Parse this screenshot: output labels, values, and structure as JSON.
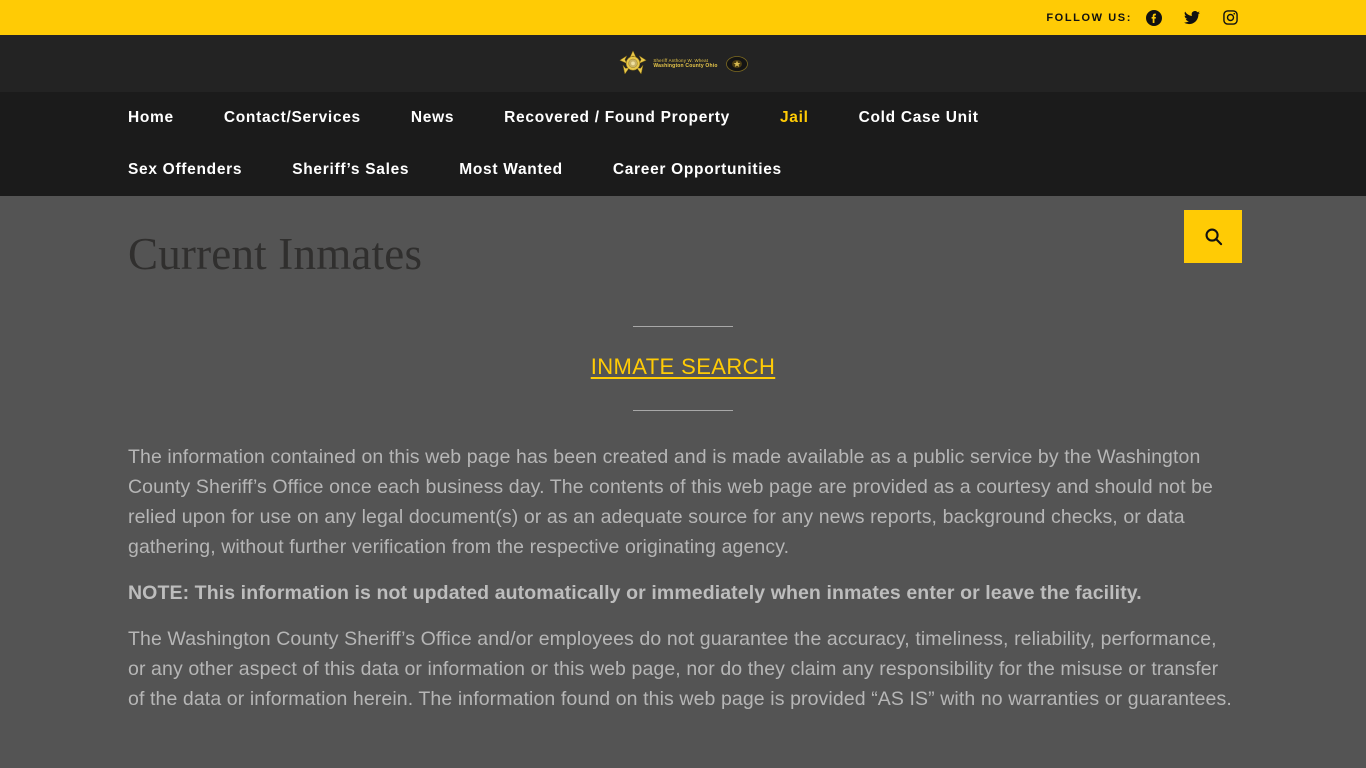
{
  "topbar": {
    "follow_label": "FOLLOW US:",
    "social": [
      {
        "name": "facebook-icon",
        "label": "Facebook"
      },
      {
        "name": "twitter-icon",
        "label": "Twitter"
      },
      {
        "name": "instagram-icon",
        "label": "Instagram"
      }
    ],
    "background_color": "#ffcb05"
  },
  "logo": {
    "line1": "Sheriff Anthony W. Wheat",
    "line2": "Washington County Ohio",
    "star_color": "#e9c84a"
  },
  "nav": {
    "row1": [
      {
        "label": "Home",
        "active": false
      },
      {
        "label": "Contact/Services",
        "active": false
      },
      {
        "label": "News",
        "active": false
      },
      {
        "label": "Recovered / Found Property",
        "active": false
      },
      {
        "label": "Jail",
        "active": true
      },
      {
        "label": "Cold Case Unit",
        "active": false
      }
    ],
    "row2": [
      {
        "label": "Sex Offenders",
        "active": false
      },
      {
        "label": "Sheriff’s Sales",
        "active": false
      },
      {
        "label": "Most Wanted",
        "active": false
      },
      {
        "label": "Career Opportunities",
        "active": false
      }
    ],
    "search_icon": "search-icon",
    "accent_color": "#ffcb05",
    "background_color": "#1b1b1b"
  },
  "main": {
    "title": "Current Inmates",
    "inmate_search_link": "INMATE SEARCH",
    "paragraph_1": "The information contained on this web page has been created and is made available as a public service by the Washington County Sheriff’s Office once each business day. The contents of this web page are provided as a courtesy and should not be relied upon for use on any legal document(s) or as an adequate source for any news reports, background checks, or data gathering,  without further verification from the respective originating agency.",
    "note": "NOTE: This information is not updated automatically or immediately when inmates enter or leave the facility.",
    "paragraph_3": "The Washington County Sheriff’s Office and/or employees do not guarantee the accuracy, timeliness, reliability, performance, or any other aspect of this data or information or this web page, nor do they claim any responsibility for the misuse or transfer of the data or information herein. The information found on this web page is provided “AS IS” with no warranties or guarantees.",
    "background_color": "#545454",
    "link_color": "#ffcb05",
    "title_color": "#302f2e"
  }
}
